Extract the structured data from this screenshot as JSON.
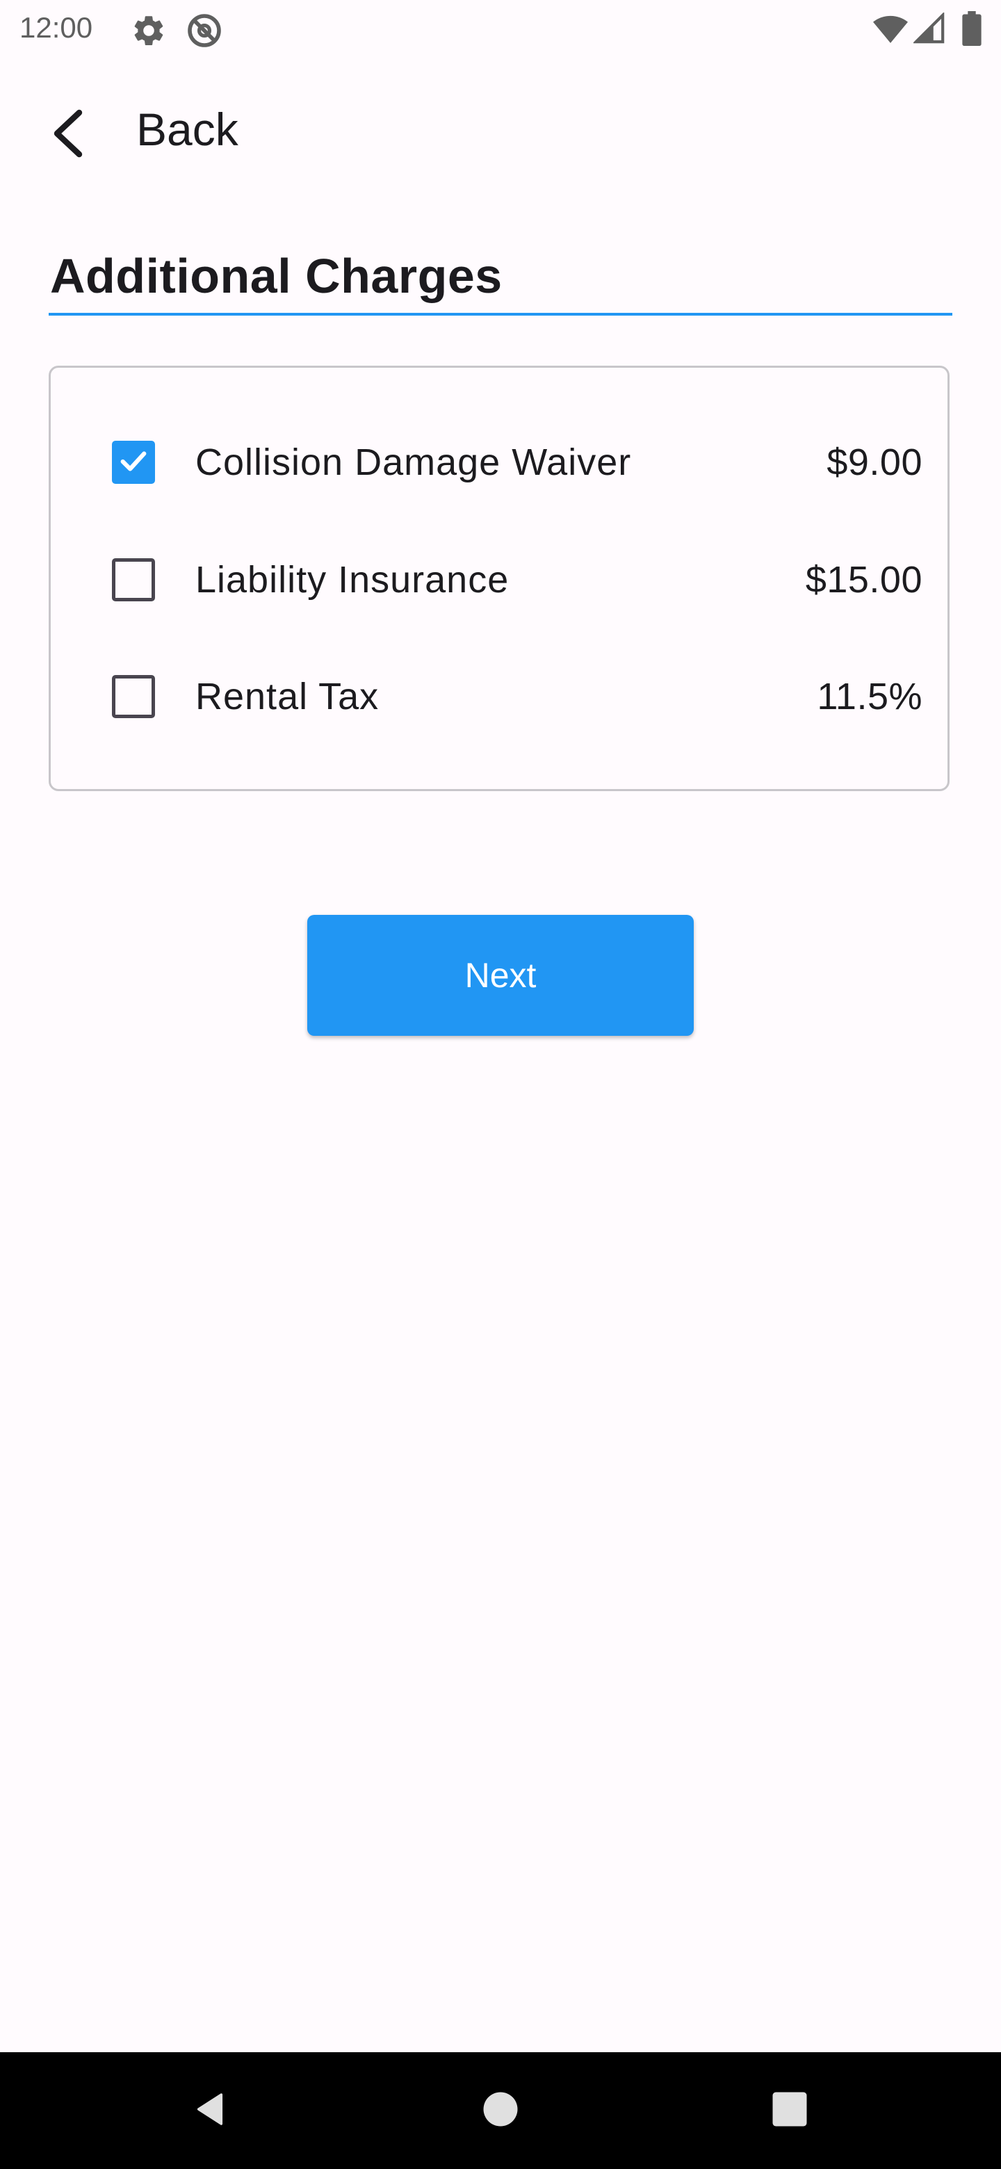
{
  "status_bar": {
    "time": "12:00",
    "icons": [
      "gear-icon",
      "no-tracking-icon",
      "wifi-icon",
      "signal-icon",
      "battery-icon"
    ]
  },
  "app_bar": {
    "back_label": "Back",
    "back_icon": "chevron-left-icon"
  },
  "page": {
    "title": "Additional Charges"
  },
  "charges": [
    {
      "label": "Collision Damage Waiver",
      "amount": "$9.00",
      "checked": true
    },
    {
      "label": "Liability Insurance",
      "amount": "$15.00",
      "checked": false
    },
    {
      "label": "Rental Tax",
      "amount": "11.5%",
      "checked": false
    }
  ],
  "actions": {
    "next_label": "Next"
  },
  "nav_bar": {
    "buttons": [
      "back-triangle-icon",
      "home-circle-icon",
      "recents-square-icon"
    ]
  },
  "colors": {
    "accent": "#2196f3",
    "background": "#fffbfe",
    "text": "#1c1b1f",
    "card_border": "#c8c6ca",
    "nav_bar": "#000000"
  }
}
